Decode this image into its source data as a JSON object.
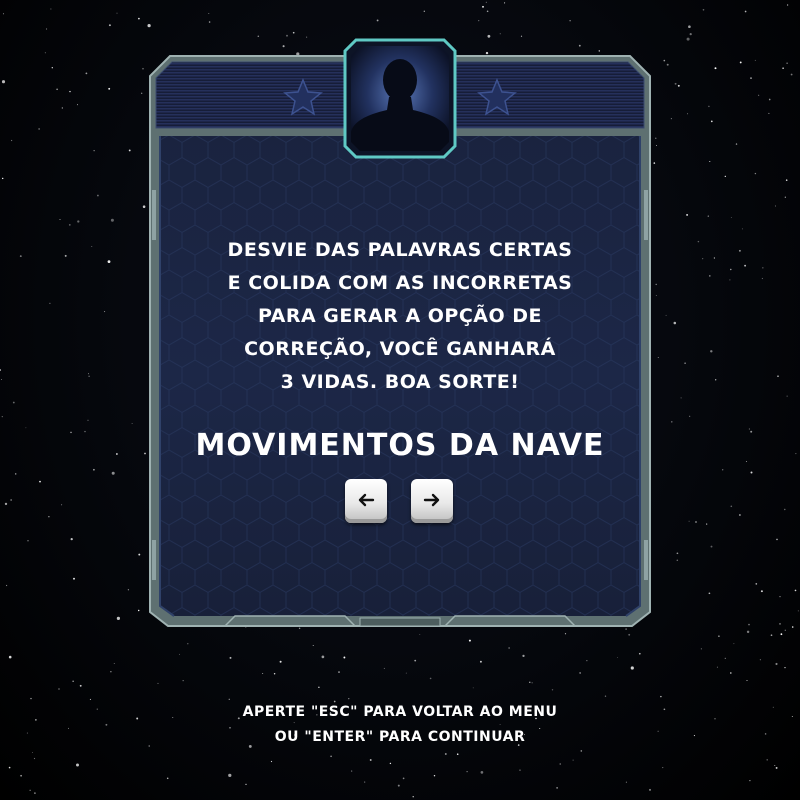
{
  "instructions": {
    "lines": [
      "DESVIE DAS PALAVRAS CERTAS",
      "E COLIDA COM AS INCORRETAS",
      "PARA GERAR A OPÇÃO DE",
      "CORREÇÃO, VOCÊ GANHARÁ",
      "3 VIDAS. BOA SORTE!"
    ]
  },
  "moves": {
    "title": "MOVIMENTOS DA NAVE",
    "keys": [
      {
        "icon": "arrow-left-icon",
        "glyph": "←"
      },
      {
        "icon": "arrow-right-icon",
        "glyph": "→"
      }
    ]
  },
  "footer": {
    "lines": [
      "APERTE \"ESC\" PARA VOLTAR AO MENU",
      "OU \"ENTER\" PARA CONTINUAR"
    ]
  },
  "colors": {
    "panel_fill": "#1b2542",
    "frame": "#7f9394",
    "accent_glow": "#5fc9c4",
    "star": "#1e2a53",
    "text": "#ffffff"
  },
  "icons": {
    "avatar": "silhouette-avatar-icon",
    "badges": [
      "star-icon",
      "star-icon"
    ]
  }
}
